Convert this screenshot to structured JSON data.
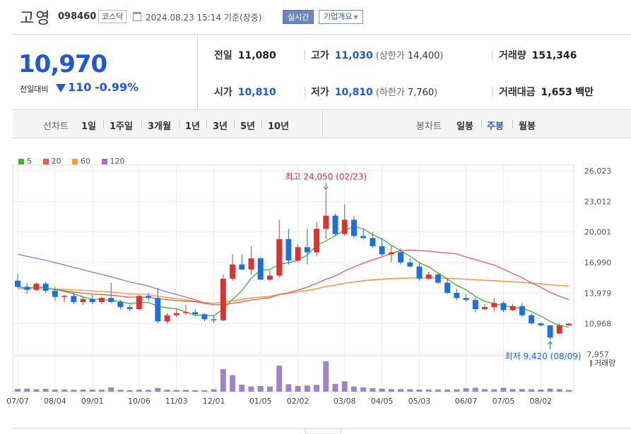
{
  "header": {
    "name": "고영",
    "code": "098460",
    "market": "코스닥",
    "timestamp": "2024.08.23 15:14 기준(장중)",
    "realtime_label": "실시간",
    "company_label": "기업개요"
  },
  "quote": {
    "price": "10,970",
    "change_label": "전일대비",
    "change": "110",
    "change_pct": "-0.99%",
    "prev_close_label": "전일",
    "prev_close": "11,080",
    "high_label": "고가",
    "high": "11,030",
    "upper_limit_label": "상한가",
    "upper_limit": "14,400",
    "volume_label": "거래량",
    "volume": "151,346",
    "open_label": "시가",
    "open": "10,810",
    "low_label": "저가",
    "low": "10,810",
    "lower_limit_label": "하한가",
    "lower_limit": "7,760",
    "amount_label": "거래대금",
    "amount": "1,653",
    "amount_unit": "백만"
  },
  "toolbar": {
    "line_chart_label": "선차트",
    "periods": [
      "1일",
      "1주일",
      "3개월",
      "1년",
      "3년",
      "5년",
      "10년"
    ],
    "candle_chart_label": "봉차트",
    "candle_periods": [
      "일봉",
      "주봉",
      "월봉"
    ],
    "active_candle": "주봉"
  },
  "colors": {
    "up": "#e03131",
    "down": "#1c6fe0",
    "ma5": "#44b033",
    "ma20": "#e65a5a",
    "ma60": "#f39c33",
    "ma120": "#a56cd6",
    "volume": "#9c84c9"
  },
  "chart_data": {
    "type": "candlestick",
    "legend": [
      {
        "name": "5",
        "color": "#44b033"
      },
      {
        "name": "20",
        "color": "#e65a5a"
      },
      {
        "name": "60",
        "color": "#f39c33"
      },
      {
        "name": "120",
        "color": "#a56cd6"
      }
    ],
    "y_ticks": [
      "26,023",
      "23,012",
      "20,001",
      "16,990",
      "13,979",
      "10,968",
      "7,957"
    ],
    "y_tick_values": [
      26023,
      23012,
      20001,
      16990,
      13979,
      10968,
      7957
    ],
    "ylim": [
      7957,
      26023
    ],
    "x_ticks": [
      {
        "label": "07/07",
        "index": 0
      },
      {
        "label": "08/04",
        "index": 4
      },
      {
        "label": "09/01",
        "index": 8
      },
      {
        "label": "10/06",
        "index": 13
      },
      {
        "label": "11/03",
        "index": 17
      },
      {
        "label": "12/01",
        "index": 21
      },
      {
        "label": "01/05",
        "index": 26
      },
      {
        "label": "02/02",
        "index": 30
      },
      {
        "label": "03/08",
        "index": 35
      },
      {
        "label": "04/05",
        "index": 39
      },
      {
        "label": "05/03",
        "index": 43
      },
      {
        "label": "06/07",
        "index": 48
      },
      {
        "label": "07/05",
        "index": 52
      },
      {
        "label": "08/02",
        "index": 56
      }
    ],
    "max_annotation": {
      "text": "최고 24,050 (02/23)",
      "index": 33,
      "value": 24050
    },
    "min_annotation": {
      "text": "최저 9,420 (08/09)",
      "index": 57,
      "value": 9420
    },
    "volume_label": "거래량",
    "candles": [
      [
        15200,
        15900,
        14500,
        14600
      ],
      [
        14600,
        15000,
        13900,
        14300
      ],
      [
        14300,
        15000,
        14200,
        14900
      ],
      [
        14900,
        15100,
        14000,
        14200
      ],
      [
        14200,
        14600,
        13200,
        13600
      ],
      [
        13600,
        13800,
        13100,
        13700
      ],
      [
        13700,
        14000,
        12900,
        13100
      ],
      [
        13100,
        13700,
        12800,
        13400
      ],
      [
        13400,
        13800,
        12900,
        13100
      ],
      [
        13100,
        13600,
        12900,
        13500
      ],
      [
        13500,
        15000,
        13000,
        13100
      ],
      [
        13100,
        13300,
        12400,
        12600
      ],
      [
        12600,
        12800,
        12200,
        12400
      ],
      [
        12400,
        13800,
        12300,
        13700
      ],
      [
        13700,
        14000,
        13200,
        13500
      ],
      [
        13500,
        14500,
        11000,
        11200
      ],
      [
        11200,
        12000,
        11000,
        11800
      ],
      [
        11800,
        12400,
        11600,
        12000
      ],
      [
        12000,
        12800,
        11800,
        12100
      ],
      [
        12100,
        12400,
        11700,
        11900
      ],
      [
        11900,
        12000,
        11200,
        11400
      ],
      [
        11400,
        11700,
        11000,
        11300
      ],
      [
        11300,
        15800,
        11200,
        15400
      ],
      [
        15400,
        17800,
        15200,
        16800
      ],
      [
        16800,
        17800,
        16300,
        16300
      ],
      [
        16300,
        18600,
        15800,
        17400
      ],
      [
        17400,
        17500,
        15300,
        15300
      ],
      [
        15300,
        16200,
        15200,
        15700
      ],
      [
        15700,
        21200,
        15500,
        19300
      ],
      [
        19300,
        20300,
        16800,
        17200
      ],
      [
        17200,
        18800,
        17000,
        18500
      ],
      [
        18500,
        20300,
        16800,
        18000
      ],
      [
        18000,
        21000,
        17600,
        20300
      ],
      [
        20300,
        24050,
        19300,
        21600
      ],
      [
        21600,
        21800,
        19600,
        19800
      ],
      [
        19800,
        22700,
        19600,
        21200
      ],
      [
        21200,
        21600,
        19400,
        19600
      ],
      [
        19600,
        20300,
        19300,
        19400
      ],
      [
        19400,
        20000,
        18400,
        18600
      ],
      [
        18600,
        19400,
        17600,
        17800
      ],
      [
        17800,
        18600,
        17000,
        18000
      ],
      [
        18000,
        18400,
        16800,
        17000
      ],
      [
        17000,
        17400,
        16500,
        16600
      ],
      [
        16600,
        17000,
        15200,
        15400
      ],
      [
        15400,
        16100,
        15300,
        15800
      ],
      [
        15800,
        16000,
        14900,
        15000
      ],
      [
        15000,
        15400,
        13900,
        14000
      ],
      [
        14000,
        14400,
        13300,
        13500
      ],
      [
        13500,
        13900,
        13100,
        13300
      ],
      [
        13300,
        13500,
        12100,
        12400
      ],
      [
        12400,
        12900,
        12300,
        12600
      ],
      [
        12600,
        13500,
        12200,
        13000
      ],
      [
        13000,
        13200,
        12100,
        12300
      ],
      [
        12300,
        12900,
        12200,
        12700
      ],
      [
        12700,
        13000,
        11600,
        11800
      ],
      [
        11800,
        12000,
        10900,
        11000
      ],
      [
        11000,
        11100,
        10700,
        10800
      ],
      [
        10800,
        10800,
        9420,
        9600
      ],
      [
        10000,
        11000,
        9900,
        10800
      ],
      [
        10810,
        11030,
        10810,
        10970
      ]
    ],
    "volume": [
      3.2,
      3.5,
      2.8,
      3.3,
      2.4,
      2.5,
      2.3,
      2.5,
      2.4,
      2.3,
      5.0,
      2.2,
      1.8,
      2.2,
      2.1,
      4.2,
      2.2,
      1.9,
      2.0,
      1.7,
      1.6,
      2.8,
      26.0,
      19.0,
      8.0,
      6.0,
      6.5,
      6.0,
      30.0,
      8.5,
      6.5,
      7.0,
      7.8,
      35.0,
      9.0,
      12.0,
      6.0,
      5.0,
      4.0,
      3.5,
      3.0,
      3.0,
      2.8,
      2.5,
      2.5,
      2.5,
      2.4,
      2.7,
      4.0,
      4.5,
      3.0,
      2.8,
      4.5,
      3.0,
      3.0,
      2.8,
      2.5,
      3.5,
      3.0,
      2.0
    ]
  }
}
